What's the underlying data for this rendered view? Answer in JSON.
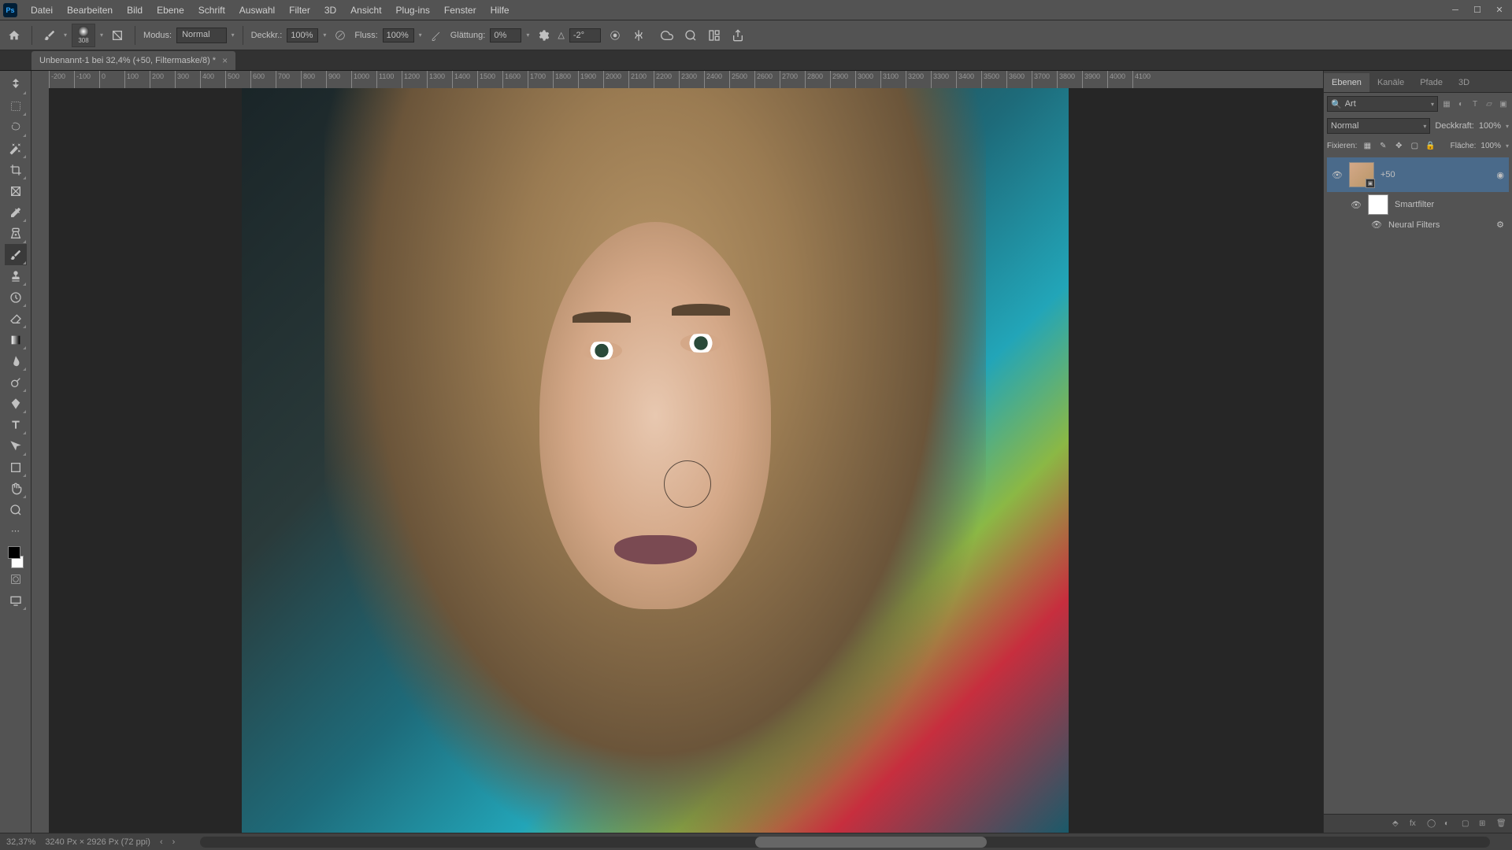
{
  "menu": {
    "items": [
      "Datei",
      "Bearbeiten",
      "Bild",
      "Ebene",
      "Schrift",
      "Auswahl",
      "Filter",
      "3D",
      "Ansicht",
      "Plug-ins",
      "Fenster",
      "Hilfe"
    ]
  },
  "brush": {
    "size": "308"
  },
  "options": {
    "modus_label": "Modus:",
    "modus_value": "Normal",
    "deckkr_label": "Deckkr.:",
    "deckkr_value": "100%",
    "fluss_label": "Fluss:",
    "fluss_value": "100%",
    "glattung_label": "Glättung:",
    "glattung_value": "0%",
    "angle_label": "△",
    "angle_value": "-2°"
  },
  "tab": {
    "title": "Unbenannt-1 bei 32,4% (+50, Filtermaske/8) *"
  },
  "ruler": {
    "ticks": [
      "-200",
      "-100",
      "0",
      "100",
      "200",
      "300",
      "400",
      "500",
      "600",
      "700",
      "800",
      "900",
      "1000",
      "1100",
      "1200",
      "1300",
      "1400",
      "1500",
      "1600",
      "1700",
      "1800",
      "1900",
      "2000",
      "2100",
      "2200",
      "2300",
      "2400",
      "2500",
      "2600",
      "2700",
      "2800",
      "2900",
      "3000",
      "3100",
      "3200",
      "3300",
      "3400",
      "3500",
      "3600",
      "3700",
      "3800",
      "3900",
      "4000",
      "4100"
    ]
  },
  "panels": {
    "tabs": [
      "Ebenen",
      "Kanäle",
      "Pfade",
      "3D"
    ],
    "search_value": "Art",
    "blend_mode": "Normal",
    "opacity_label": "Deckkraft:",
    "opacity_value": "100%",
    "lock_label": "Fixieren:",
    "fill_label": "Fläche:",
    "fill_value": "100%",
    "layer_name": "+50",
    "smartfilter_label": "Smartfilter",
    "neural_label": "Neural Filters"
  },
  "status": {
    "zoom": "32,37%",
    "doc": "3240 Px × 2926 Px (72 ppi)"
  }
}
